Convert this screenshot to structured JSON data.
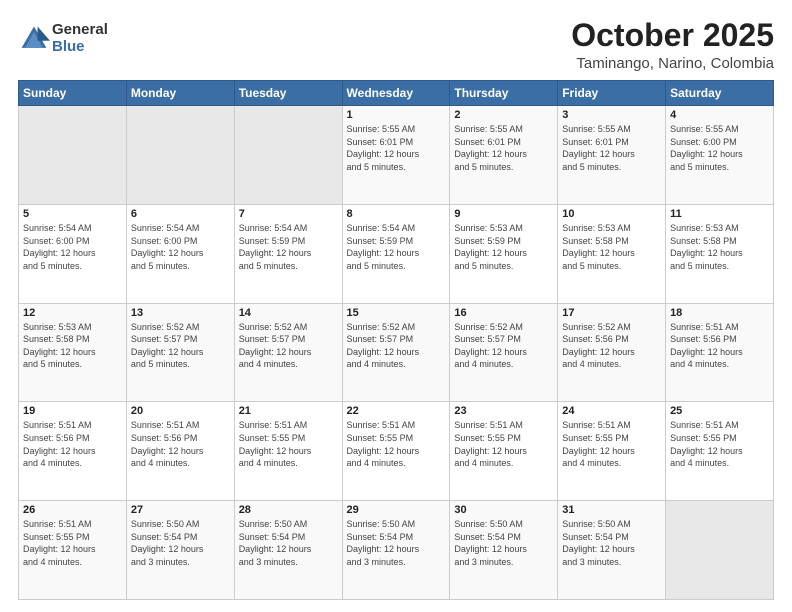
{
  "header": {
    "logo": {
      "general": "General",
      "blue": "Blue"
    },
    "title": "October 2025",
    "location": "Taminango, Narino, Colombia"
  },
  "weekdays": [
    "Sunday",
    "Monday",
    "Tuesday",
    "Wednesday",
    "Thursday",
    "Friday",
    "Saturday"
  ],
  "weeks": [
    [
      {
        "day": "",
        "info": ""
      },
      {
        "day": "",
        "info": ""
      },
      {
        "day": "",
        "info": ""
      },
      {
        "day": "1",
        "info": "Sunrise: 5:55 AM\nSunset: 6:01 PM\nDaylight: 12 hours\nand 5 minutes."
      },
      {
        "day": "2",
        "info": "Sunrise: 5:55 AM\nSunset: 6:01 PM\nDaylight: 12 hours\nand 5 minutes."
      },
      {
        "day": "3",
        "info": "Sunrise: 5:55 AM\nSunset: 6:01 PM\nDaylight: 12 hours\nand 5 minutes."
      },
      {
        "day": "4",
        "info": "Sunrise: 5:55 AM\nSunset: 6:00 PM\nDaylight: 12 hours\nand 5 minutes."
      }
    ],
    [
      {
        "day": "5",
        "info": "Sunrise: 5:54 AM\nSunset: 6:00 PM\nDaylight: 12 hours\nand 5 minutes."
      },
      {
        "day": "6",
        "info": "Sunrise: 5:54 AM\nSunset: 6:00 PM\nDaylight: 12 hours\nand 5 minutes."
      },
      {
        "day": "7",
        "info": "Sunrise: 5:54 AM\nSunset: 5:59 PM\nDaylight: 12 hours\nand 5 minutes."
      },
      {
        "day": "8",
        "info": "Sunrise: 5:54 AM\nSunset: 5:59 PM\nDaylight: 12 hours\nand 5 minutes."
      },
      {
        "day": "9",
        "info": "Sunrise: 5:53 AM\nSunset: 5:59 PM\nDaylight: 12 hours\nand 5 minutes."
      },
      {
        "day": "10",
        "info": "Sunrise: 5:53 AM\nSunset: 5:58 PM\nDaylight: 12 hours\nand 5 minutes."
      },
      {
        "day": "11",
        "info": "Sunrise: 5:53 AM\nSunset: 5:58 PM\nDaylight: 12 hours\nand 5 minutes."
      }
    ],
    [
      {
        "day": "12",
        "info": "Sunrise: 5:53 AM\nSunset: 5:58 PM\nDaylight: 12 hours\nand 5 minutes."
      },
      {
        "day": "13",
        "info": "Sunrise: 5:52 AM\nSunset: 5:57 PM\nDaylight: 12 hours\nand 5 minutes."
      },
      {
        "day": "14",
        "info": "Sunrise: 5:52 AM\nSunset: 5:57 PM\nDaylight: 12 hours\nand 4 minutes."
      },
      {
        "day": "15",
        "info": "Sunrise: 5:52 AM\nSunset: 5:57 PM\nDaylight: 12 hours\nand 4 minutes."
      },
      {
        "day": "16",
        "info": "Sunrise: 5:52 AM\nSunset: 5:57 PM\nDaylight: 12 hours\nand 4 minutes."
      },
      {
        "day": "17",
        "info": "Sunrise: 5:52 AM\nSunset: 5:56 PM\nDaylight: 12 hours\nand 4 minutes."
      },
      {
        "day": "18",
        "info": "Sunrise: 5:51 AM\nSunset: 5:56 PM\nDaylight: 12 hours\nand 4 minutes."
      }
    ],
    [
      {
        "day": "19",
        "info": "Sunrise: 5:51 AM\nSunset: 5:56 PM\nDaylight: 12 hours\nand 4 minutes."
      },
      {
        "day": "20",
        "info": "Sunrise: 5:51 AM\nSunset: 5:56 PM\nDaylight: 12 hours\nand 4 minutes."
      },
      {
        "day": "21",
        "info": "Sunrise: 5:51 AM\nSunset: 5:55 PM\nDaylight: 12 hours\nand 4 minutes."
      },
      {
        "day": "22",
        "info": "Sunrise: 5:51 AM\nSunset: 5:55 PM\nDaylight: 12 hours\nand 4 minutes."
      },
      {
        "day": "23",
        "info": "Sunrise: 5:51 AM\nSunset: 5:55 PM\nDaylight: 12 hours\nand 4 minutes."
      },
      {
        "day": "24",
        "info": "Sunrise: 5:51 AM\nSunset: 5:55 PM\nDaylight: 12 hours\nand 4 minutes."
      },
      {
        "day": "25",
        "info": "Sunrise: 5:51 AM\nSunset: 5:55 PM\nDaylight: 12 hours\nand 4 minutes."
      }
    ],
    [
      {
        "day": "26",
        "info": "Sunrise: 5:51 AM\nSunset: 5:55 PM\nDaylight: 12 hours\nand 4 minutes."
      },
      {
        "day": "27",
        "info": "Sunrise: 5:50 AM\nSunset: 5:54 PM\nDaylight: 12 hours\nand 3 minutes."
      },
      {
        "day": "28",
        "info": "Sunrise: 5:50 AM\nSunset: 5:54 PM\nDaylight: 12 hours\nand 3 minutes."
      },
      {
        "day": "29",
        "info": "Sunrise: 5:50 AM\nSunset: 5:54 PM\nDaylight: 12 hours\nand 3 minutes."
      },
      {
        "day": "30",
        "info": "Sunrise: 5:50 AM\nSunset: 5:54 PM\nDaylight: 12 hours\nand 3 minutes."
      },
      {
        "day": "31",
        "info": "Sunrise: 5:50 AM\nSunset: 5:54 PM\nDaylight: 12 hours\nand 3 minutes."
      },
      {
        "day": "",
        "info": ""
      }
    ]
  ]
}
